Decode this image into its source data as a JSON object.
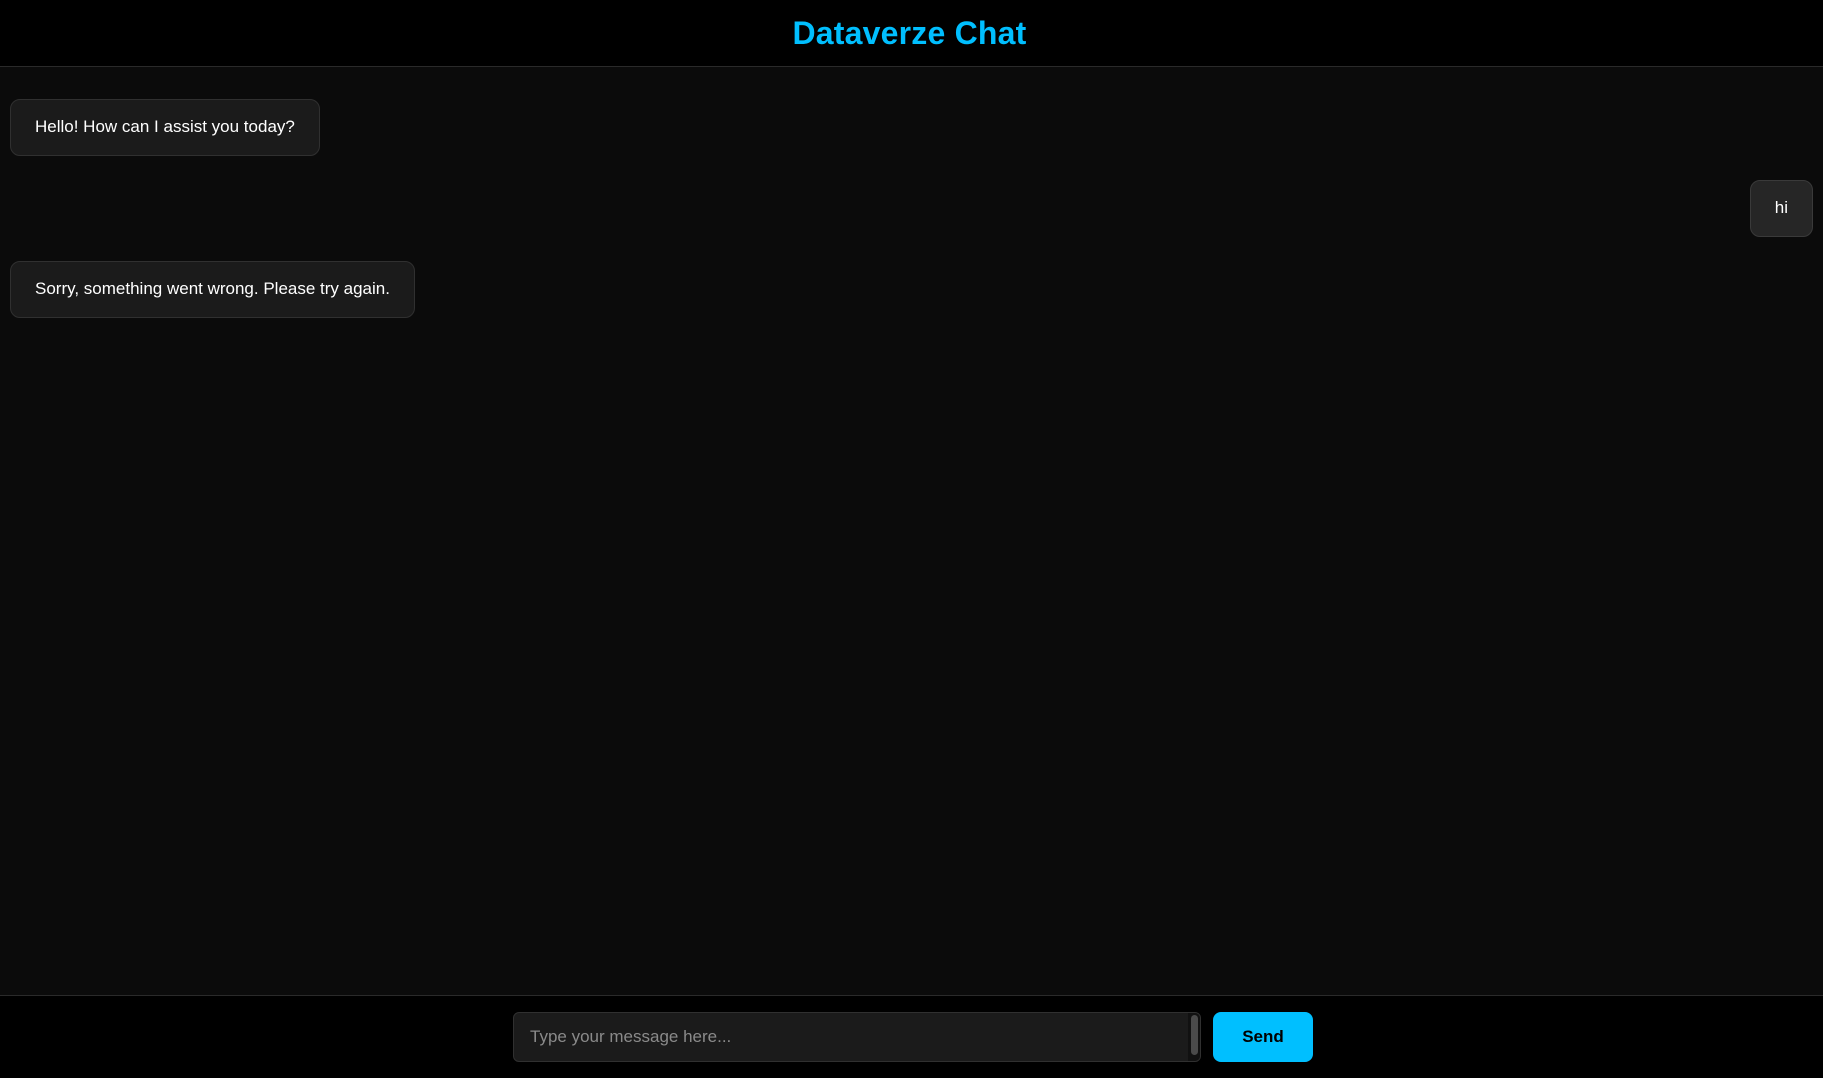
{
  "header": {
    "title": "Dataverze Chat"
  },
  "messages": [
    {
      "role": "bot",
      "text": "Hello! How can I assist you today?"
    },
    {
      "role": "user",
      "text": "hi"
    },
    {
      "role": "bot",
      "text": "Sorry, something went wrong. Please try again."
    }
  ],
  "composer": {
    "placeholder": "Type your message here...",
    "value": "",
    "send_label": "Send"
  },
  "colors": {
    "accent": "#00bfff",
    "background": "#0b0b0b",
    "header_background": "#000000",
    "bubble_background": "#1b1b1b"
  }
}
